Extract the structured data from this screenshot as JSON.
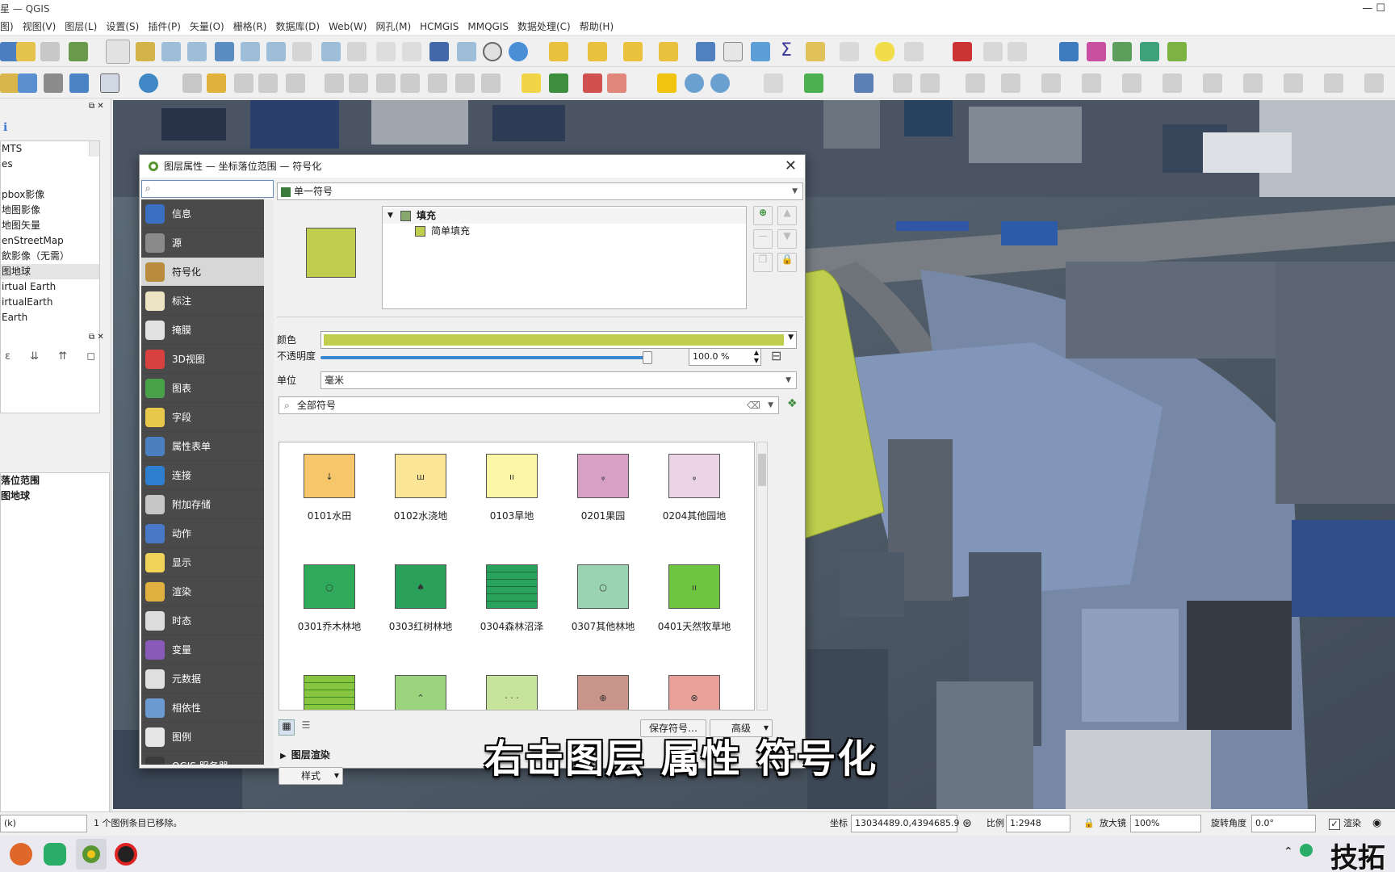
{
  "window": {
    "title": "星 — QGIS",
    "controls": "—  ☐"
  },
  "menu": [
    "图)",
    "视图(V)",
    "图层(L)",
    "设置(S)",
    "插件(P)",
    "矢量(O)",
    "栅格(R)",
    "数据库(D)",
    "Web(W)",
    "网孔(M)",
    "HCMGIS",
    "MMQGIS",
    "数据处理(C)",
    "帮助(H)"
  ],
  "browser": {
    "items": [
      "MTS",
      "es",
      "",
      "pbox影像",
      "地图影像",
      "地图矢量",
      "enStreetMap",
      "飲影像（无需）",
      "图地球",
      "irtual Earth",
      "irtualEarth",
      "Earth"
    ]
  },
  "layers": {
    "items": [
      "落位范围",
      "图地球"
    ]
  },
  "dialog": {
    "title": "图层属性 — 坐标落位范围 — 符号化",
    "sidebar": [
      {
        "label": "信息",
        "icon": "info-icon"
      },
      {
        "label": "源",
        "icon": "source-icon"
      },
      {
        "label": "符号化",
        "icon": "paintbrush-icon",
        "active": true
      },
      {
        "label": "标注",
        "icon": "label-icon"
      },
      {
        "label": "掩膜",
        "icon": "mask-icon"
      },
      {
        "label": "3D视图",
        "icon": "cube-icon"
      },
      {
        "label": "图表",
        "icon": "diagram-icon"
      },
      {
        "label": "字段",
        "icon": "fields-icon"
      },
      {
        "label": "属性表单",
        "icon": "form-icon"
      },
      {
        "label": "连接",
        "icon": "join-icon"
      },
      {
        "label": "附加存储",
        "icon": "storage-icon"
      },
      {
        "label": "动作",
        "icon": "action-icon"
      },
      {
        "label": "显示",
        "icon": "display-icon"
      },
      {
        "label": "渲染",
        "icon": "render-icon"
      },
      {
        "label": "时态",
        "icon": "clock-icon"
      },
      {
        "label": "变量",
        "icon": "variable-icon"
      },
      {
        "label": "元数据",
        "icon": "metadata-icon"
      },
      {
        "label": "相依性",
        "icon": "dependency-icon"
      },
      {
        "label": "图例",
        "icon": "legend-icon"
      },
      {
        "label": "QGIS 服务器",
        "icon": "server-icon"
      }
    ],
    "renderer": "单一符号",
    "tree": {
      "root": "填充",
      "child": "简单填充"
    },
    "color_label": "颜色",
    "fill_color": "#bfcf4d",
    "opacity_label": "不透明度",
    "opacity_value": "100.0 %",
    "opacity_level": 1.0,
    "unit_label": "单位",
    "unit_value": "毫米",
    "symbol_filter": "全部符号",
    "symbols": [
      {
        "name": "0101水田",
        "color": "#f5c66a",
        "mark": "↓"
      },
      {
        "name": "0102水浇地",
        "color": "#fbe697",
        "mark": "ш"
      },
      {
        "name": "0103旱地",
        "color": "#fbf5a6",
        "mark": "ıı"
      },
      {
        "name": "0201果园",
        "color": "#d7a1c6",
        "mark": "ᵩ"
      },
      {
        "name": "0204其他园地",
        "color": "#ead4e6",
        "mark": "ᵩ"
      },
      {
        "name": "0301乔木林地",
        "color": "#2faa5a",
        "mark": "○"
      },
      {
        "name": "0303红树林地",
        "color": "#2aa05a",
        "mark": "♠"
      },
      {
        "name": "0304森林沼泽",
        "color": "#29a35c",
        "mark": ""
      },
      {
        "name": "0307其他林地",
        "color": "#99d3b2",
        "mark": "○"
      },
      {
        "name": "0401天然牧草地",
        "color": "#6ec53f",
        "mark": "ıı"
      },
      {
        "name": "",
        "color": "#87c541",
        "mark": ""
      },
      {
        "name": "",
        "color": "#9cd47e",
        "mark": "⌃"
      },
      {
        "name": "",
        "color": "#c8e49c",
        "mark": "· · ·"
      },
      {
        "name": "",
        "color": "#c9958a",
        "mark": "⊕"
      },
      {
        "name": "",
        "color": "#e8a199",
        "mark": "⊗"
      }
    ],
    "save_symbol": "保存符号…",
    "advanced": "高级",
    "layer_rendering": "图层渲染",
    "style": "样式"
  },
  "subtitle": "右击图层 属性 符号化",
  "status": {
    "message": "1 个图例条目已移除。",
    "coord_label": "坐标",
    "coord_value": "13034489.0,4394685.9",
    "scale_label": "比例",
    "scale_value": "1:2948",
    "magnifier_label": "放大镜",
    "magnifier_value": "100%",
    "rotation_label": "旋转角度",
    "rotation_value": "0.0°",
    "render_label": "渲染",
    "left_field": "(k)"
  },
  "watermark": "技拓"
}
